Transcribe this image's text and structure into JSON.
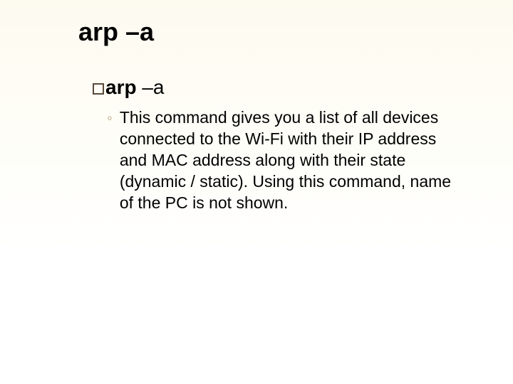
{
  "title": {
    "cmd": "arp",
    "flag": "–a"
  },
  "subhead": {
    "cmd": "arp",
    "flag": "–a"
  },
  "body": {
    "bullet_glyph": "◦",
    "text": "This command gives you a list of all devices connected to the Wi-Fi with their IP address and MAC address along with their state (dynamic / static). Using this command, name of the PC is not shown."
  }
}
